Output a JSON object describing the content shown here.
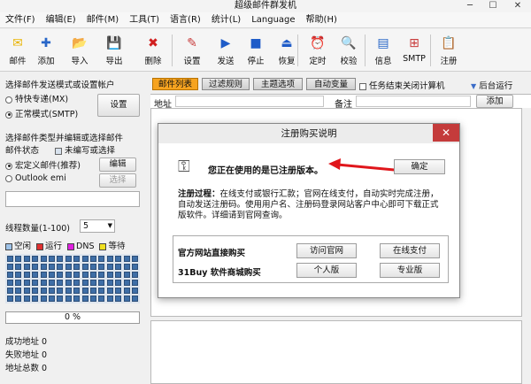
{
  "window": {
    "title": "超级邮件群发机"
  },
  "menu": [
    "文件(F)",
    "编辑(E)",
    "邮件(M)",
    "工具(T)",
    "语言(R)",
    "统计(L)",
    "Language",
    "帮助(H)"
  ],
  "toolbar": [
    {
      "label": "邮件",
      "icon": "envelope-icon",
      "glyph": "✉"
    },
    {
      "label": "添加",
      "icon": "add-icon",
      "glyph": "✚"
    },
    {
      "label": "导入",
      "icon": "import-icon",
      "glyph": "📂"
    },
    {
      "label": "导出",
      "icon": "export-icon",
      "glyph": "💾"
    },
    {
      "label": "删除",
      "icon": "delete-icon",
      "glyph": "✖"
    },
    {
      "label": "设置",
      "icon": "settings-icon",
      "glyph": "✎"
    },
    {
      "label": "发送",
      "icon": "send-icon",
      "glyph": "▶"
    },
    {
      "label": "停止",
      "icon": "stop-icon",
      "glyph": "■"
    },
    {
      "label": "恢复",
      "icon": "resume-icon",
      "glyph": "⏏"
    },
    {
      "label": "定时",
      "icon": "clock-icon",
      "glyph": "⏰"
    },
    {
      "label": "校验",
      "icon": "verify-icon",
      "glyph": "🔍"
    },
    {
      "label": "信息",
      "icon": "info-icon",
      "glyph": "▤"
    },
    {
      "label": "SMTP",
      "icon": "smtp-icon",
      "glyph": "⊞"
    },
    {
      "label": "注册",
      "icon": "register-icon",
      "glyph": "📋"
    }
  ],
  "left": {
    "send_mode_title": "选择邮件发送模式或设置帐户",
    "mode_fast": "特快专递(MX)",
    "mode_normal": "正常模式(SMTP)",
    "settings_btn": "设置",
    "mail_type_title": "选择邮件类型并编辑或选择邮件",
    "mail_status_label": "邮件状态",
    "unedited_label": "未编写或选择",
    "custom_mail": "宏定义邮件(推荐)",
    "edit_btn": "编辑",
    "outlook_mail": "Outlook emi",
    "select_btn": "选择",
    "threads_label": "线程数量(1-100)",
    "threads_value": "5",
    "legend": [
      {
        "label": "空闲",
        "color": "#9fc3e8"
      },
      {
        "label": "运行",
        "color": "#e03030"
      },
      {
        "label": "DNS",
        "color": "#e020e0"
      },
      {
        "label": "等待",
        "color": "#f0e020"
      }
    ],
    "progress": "0 %",
    "progress_value": 0,
    "success_label": "成功地址",
    "success_value": "0",
    "fail_label": "失败地址",
    "fail_value": "0",
    "total_label": "地址总数",
    "total_value": "0"
  },
  "tabs": [
    "邮件列表",
    "过滤规则",
    "主题选项",
    "自动变量"
  ],
  "shutdown_label": "任务结束关闭计算机",
  "background_label": "后台运行",
  "addr": {
    "address_label": "地址",
    "note_label": "备注",
    "add_btn": "添加"
  },
  "dialog": {
    "title": "注册购买说明",
    "close": "✕",
    "message": "您正在使用的是已注册版本。",
    "ok": "确定",
    "process_label": "注册过程：",
    "process_text": "在线支付或银行汇款；官网在线支付，自动实时完成注册，自动发送注册码。使用用户名、注册码登录网站客户中心即可下载正式版软件。详细请到官网查询。",
    "official_label": "官方网站直接购买",
    "official_btn1": "访问官网",
    "official_btn2": "在线支付",
    "buy31_label": "31Buy 软件商城购买",
    "buy31_btn1": "个人版",
    "buy31_btn2": "专业版"
  },
  "colors": {
    "active_tab": "#f6a320",
    "arrow": "#e0161b",
    "cell": "#3e6ea6"
  }
}
